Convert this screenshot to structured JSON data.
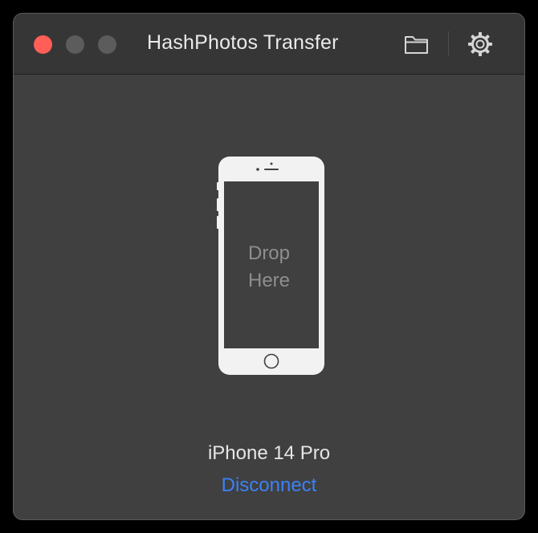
{
  "window": {
    "title": "HashPhotos Transfer"
  },
  "toolbar": {
    "folder_icon": "folder-icon",
    "settings_icon": "gear-icon"
  },
  "drop_zone": {
    "line1": "Drop",
    "line2": "Here",
    "device_icon": "iphone-icon"
  },
  "device": {
    "name": "iPhone 14 Pro",
    "disconnect_label": "Disconnect"
  },
  "colors": {
    "close": "#ff5f57",
    "accent_link": "#3a82f7",
    "background": "#404040",
    "phone_body": "#f2f2f2"
  }
}
